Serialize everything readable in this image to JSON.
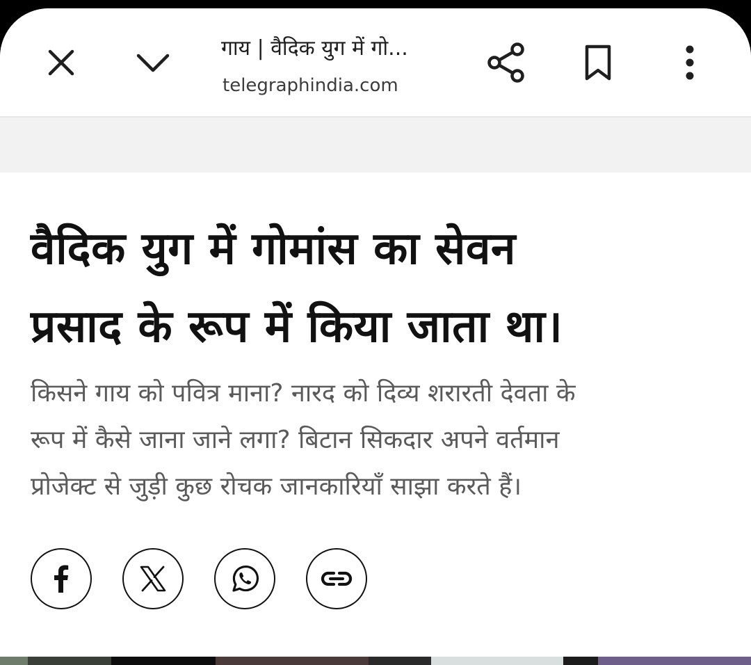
{
  "toolbar": {
    "page_title": "गाय | वैदिक युग में गो...",
    "domain": "telegraphindia.com",
    "close_icon": "close-icon",
    "minimize_icon": "chevron-down-icon",
    "share_icon": "share-icon",
    "bookmark_icon": "bookmark-icon",
    "more_icon": "more-vert-icon"
  },
  "article": {
    "headline_line1": "वैदिक युग में गोमांस का सेवन",
    "headline_line2": "प्रसाद के रूप में किया जाता था।",
    "summary_line1": "किसने गाय को पवित्र माना? नारद को दिव्य शरारती देवता के",
    "summary_line2": "रूप में कैसे जाना जाने लगा? बिटान सिकदार अपने वर्तमान",
    "summary_line3": "प्रोजेक्ट से जुड़ी कुछ रोचक जानकारियाँ साझा करते हैं।"
  },
  "share_buttons": [
    {
      "icon": "facebook-icon"
    },
    {
      "icon": "x-icon"
    },
    {
      "icon": "whatsapp-icon"
    },
    {
      "icon": "link-icon"
    }
  ],
  "colors": {
    "headline": "#111111",
    "summary": "#5a5a5a",
    "band": "#f2f2f2"
  }
}
